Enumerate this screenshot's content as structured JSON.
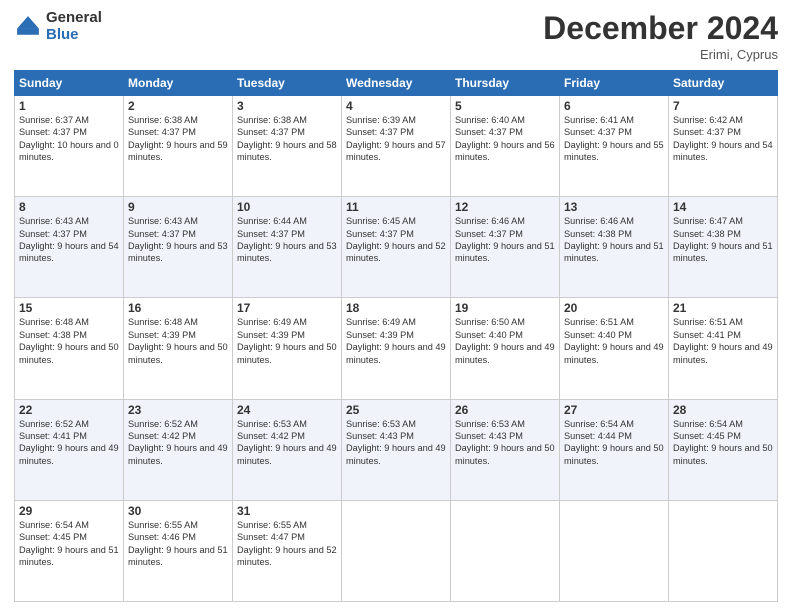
{
  "logo": {
    "general": "General",
    "blue": "Blue"
  },
  "header": {
    "month": "December 2024",
    "location": "Erimi, Cyprus"
  },
  "weekdays": [
    "Sunday",
    "Monday",
    "Tuesday",
    "Wednesday",
    "Thursday",
    "Friday",
    "Saturday"
  ],
  "weeks": [
    [
      {
        "day": "1",
        "sunrise": "6:37 AM",
        "sunset": "4:37 PM",
        "daylight": "10 hours and 0 minutes."
      },
      {
        "day": "2",
        "sunrise": "6:38 AM",
        "sunset": "4:37 PM",
        "daylight": "9 hours and 59 minutes."
      },
      {
        "day": "3",
        "sunrise": "6:38 AM",
        "sunset": "4:37 PM",
        "daylight": "9 hours and 58 minutes."
      },
      {
        "day": "4",
        "sunrise": "6:39 AM",
        "sunset": "4:37 PM",
        "daylight": "9 hours and 57 minutes."
      },
      {
        "day": "5",
        "sunrise": "6:40 AM",
        "sunset": "4:37 PM",
        "daylight": "9 hours and 56 minutes."
      },
      {
        "day": "6",
        "sunrise": "6:41 AM",
        "sunset": "4:37 PM",
        "daylight": "9 hours and 55 minutes."
      },
      {
        "day": "7",
        "sunrise": "6:42 AM",
        "sunset": "4:37 PM",
        "daylight": "9 hours and 54 minutes."
      }
    ],
    [
      {
        "day": "8",
        "sunrise": "6:43 AM",
        "sunset": "4:37 PM",
        "daylight": "9 hours and 54 minutes."
      },
      {
        "day": "9",
        "sunrise": "6:43 AM",
        "sunset": "4:37 PM",
        "daylight": "9 hours and 53 minutes."
      },
      {
        "day": "10",
        "sunrise": "6:44 AM",
        "sunset": "4:37 PM",
        "daylight": "9 hours and 53 minutes."
      },
      {
        "day": "11",
        "sunrise": "6:45 AM",
        "sunset": "4:37 PM",
        "daylight": "9 hours and 52 minutes."
      },
      {
        "day": "12",
        "sunrise": "6:46 AM",
        "sunset": "4:37 PM",
        "daylight": "9 hours and 51 minutes."
      },
      {
        "day": "13",
        "sunrise": "6:46 AM",
        "sunset": "4:38 PM",
        "daylight": "9 hours and 51 minutes."
      },
      {
        "day": "14",
        "sunrise": "6:47 AM",
        "sunset": "4:38 PM",
        "daylight": "9 hours and 51 minutes."
      }
    ],
    [
      {
        "day": "15",
        "sunrise": "6:48 AM",
        "sunset": "4:38 PM",
        "daylight": "9 hours and 50 minutes."
      },
      {
        "day": "16",
        "sunrise": "6:48 AM",
        "sunset": "4:39 PM",
        "daylight": "9 hours and 50 minutes."
      },
      {
        "day": "17",
        "sunrise": "6:49 AM",
        "sunset": "4:39 PM",
        "daylight": "9 hours and 50 minutes."
      },
      {
        "day": "18",
        "sunrise": "6:49 AM",
        "sunset": "4:39 PM",
        "daylight": "9 hours and 49 minutes."
      },
      {
        "day": "19",
        "sunrise": "6:50 AM",
        "sunset": "4:40 PM",
        "daylight": "9 hours and 49 minutes."
      },
      {
        "day": "20",
        "sunrise": "6:51 AM",
        "sunset": "4:40 PM",
        "daylight": "9 hours and 49 minutes."
      },
      {
        "day": "21",
        "sunrise": "6:51 AM",
        "sunset": "4:41 PM",
        "daylight": "9 hours and 49 minutes."
      }
    ],
    [
      {
        "day": "22",
        "sunrise": "6:52 AM",
        "sunset": "4:41 PM",
        "daylight": "9 hours and 49 minutes."
      },
      {
        "day": "23",
        "sunrise": "6:52 AM",
        "sunset": "4:42 PM",
        "daylight": "9 hours and 49 minutes."
      },
      {
        "day": "24",
        "sunrise": "6:53 AM",
        "sunset": "4:42 PM",
        "daylight": "9 hours and 49 minutes."
      },
      {
        "day": "25",
        "sunrise": "6:53 AM",
        "sunset": "4:43 PM",
        "daylight": "9 hours and 49 minutes."
      },
      {
        "day": "26",
        "sunrise": "6:53 AM",
        "sunset": "4:43 PM",
        "daylight": "9 hours and 50 minutes."
      },
      {
        "day": "27",
        "sunrise": "6:54 AM",
        "sunset": "4:44 PM",
        "daylight": "9 hours and 50 minutes."
      },
      {
        "day": "28",
        "sunrise": "6:54 AM",
        "sunset": "4:45 PM",
        "daylight": "9 hours and 50 minutes."
      }
    ],
    [
      {
        "day": "29",
        "sunrise": "6:54 AM",
        "sunset": "4:45 PM",
        "daylight": "9 hours and 51 minutes."
      },
      {
        "day": "30",
        "sunrise": "6:55 AM",
        "sunset": "4:46 PM",
        "daylight": "9 hours and 51 minutes."
      },
      {
        "day": "31",
        "sunrise": "6:55 AM",
        "sunset": "4:47 PM",
        "daylight": "9 hours and 52 minutes."
      },
      null,
      null,
      null,
      null
    ]
  ],
  "labels": {
    "sunrise": "Sunrise:",
    "sunset": "Sunset:",
    "daylight": "Daylight:"
  }
}
